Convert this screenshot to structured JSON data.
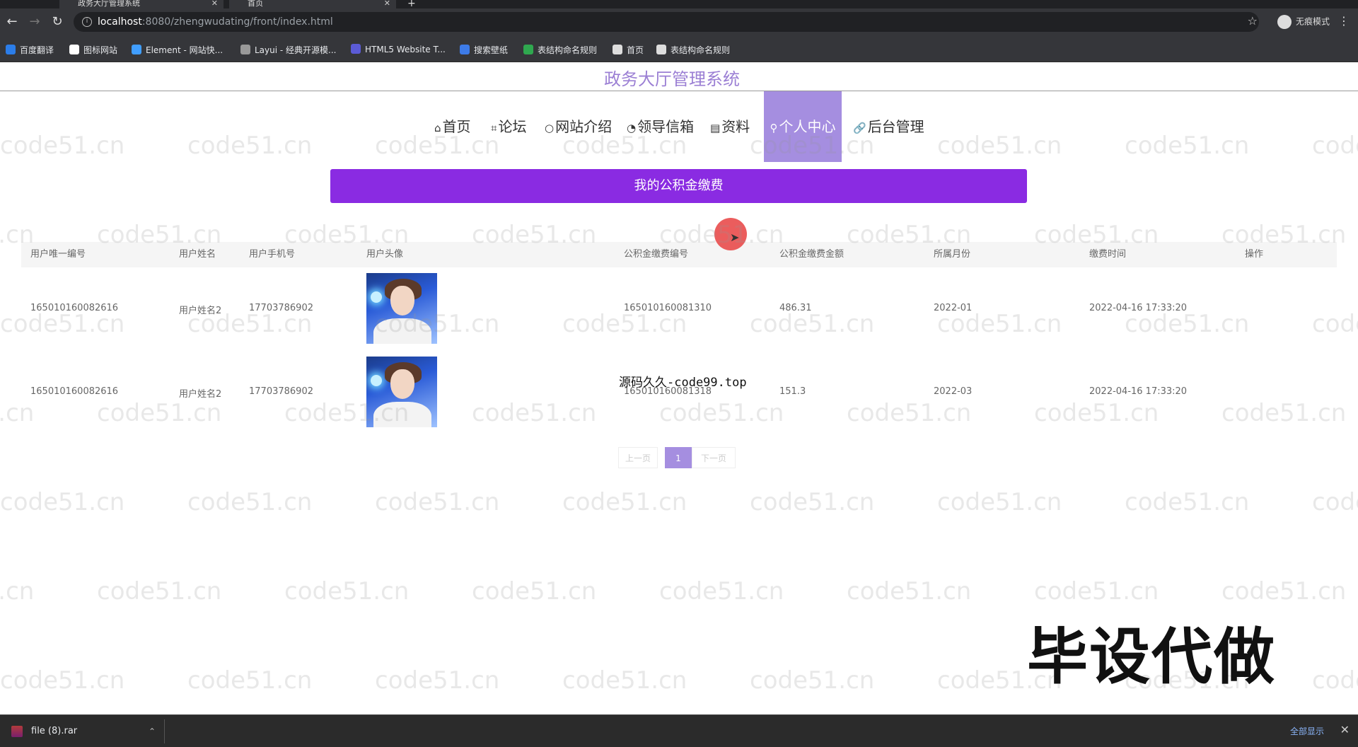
{
  "browser": {
    "tabs": [
      {
        "title": "政务大厅管理系统"
      },
      {
        "title": "首页"
      }
    ],
    "url_host": "localhost",
    "url_path": ":8080/zhengwudating/front/index.html",
    "incognito_label": "无痕模式",
    "bookmarks": [
      {
        "label": "百度翻译",
        "color": "#2b7de9"
      },
      {
        "label": "图标网站",
        "color": "#ffffff"
      },
      {
        "label": "Element - 网站快...",
        "color": "#409eff"
      },
      {
        "label": "Layui - 经典开源模...",
        "color": "#999999"
      },
      {
        "label": "HTML5 Website T...",
        "color": "#5b5bd6"
      },
      {
        "label": "搜索壁纸",
        "color": "#3d7be8"
      },
      {
        "label": "表结构命名规则",
        "color": "#2fa84f"
      },
      {
        "label": "首页",
        "color": "#dddddd"
      },
      {
        "label": "表结构命名规则",
        "color": "#dddddd"
      }
    ]
  },
  "site": {
    "title": "政务大厅管理系统",
    "nav": [
      {
        "icon": "⌂",
        "label": "首页"
      },
      {
        "icon": "⌗",
        "label": "论坛"
      },
      {
        "icon": "○",
        "label": "网站介绍"
      },
      {
        "icon": "◔",
        "label": "领导信箱"
      },
      {
        "icon": "▤",
        "label": "资料"
      },
      {
        "icon": "⚲",
        "label": "个人中心"
      },
      {
        "icon": "🔗",
        "label": "后台管理"
      }
    ],
    "active_nav": "个人中心",
    "section_title": "我的公积金缴费"
  },
  "table": {
    "headers": [
      "用户唯一编号",
      "用户姓名",
      "用户手机号",
      "用户头像",
      "公积金缴费编号",
      "公积金缴费金额",
      "所属月份",
      "缴费时间",
      "操作"
    ],
    "rows": [
      {
        "user_id": "165010160082616",
        "user_name": "用户姓名2",
        "phone": "17703786902",
        "fund_id": "165010160081310",
        "amount": "486.31",
        "month": "2022-01",
        "paid_at": "2022-04-16 17:33:20"
      },
      {
        "user_id": "165010160082616",
        "user_name": "用户姓名2",
        "phone": "17703786902",
        "fund_id": "165010160081318",
        "amount": "151.3",
        "month": "2022-03",
        "paid_at": "2022-04-16 17:33:20"
      }
    ]
  },
  "pagination": {
    "prev": "上一页",
    "current": "1",
    "next": "下一页"
  },
  "overlay": {
    "code_text": "源码久久-code99.top",
    "big_text": "毕设代做",
    "watermark": "code51.cn"
  },
  "downloads": {
    "file": "file (8).rar",
    "show_all": "全部显示"
  }
}
